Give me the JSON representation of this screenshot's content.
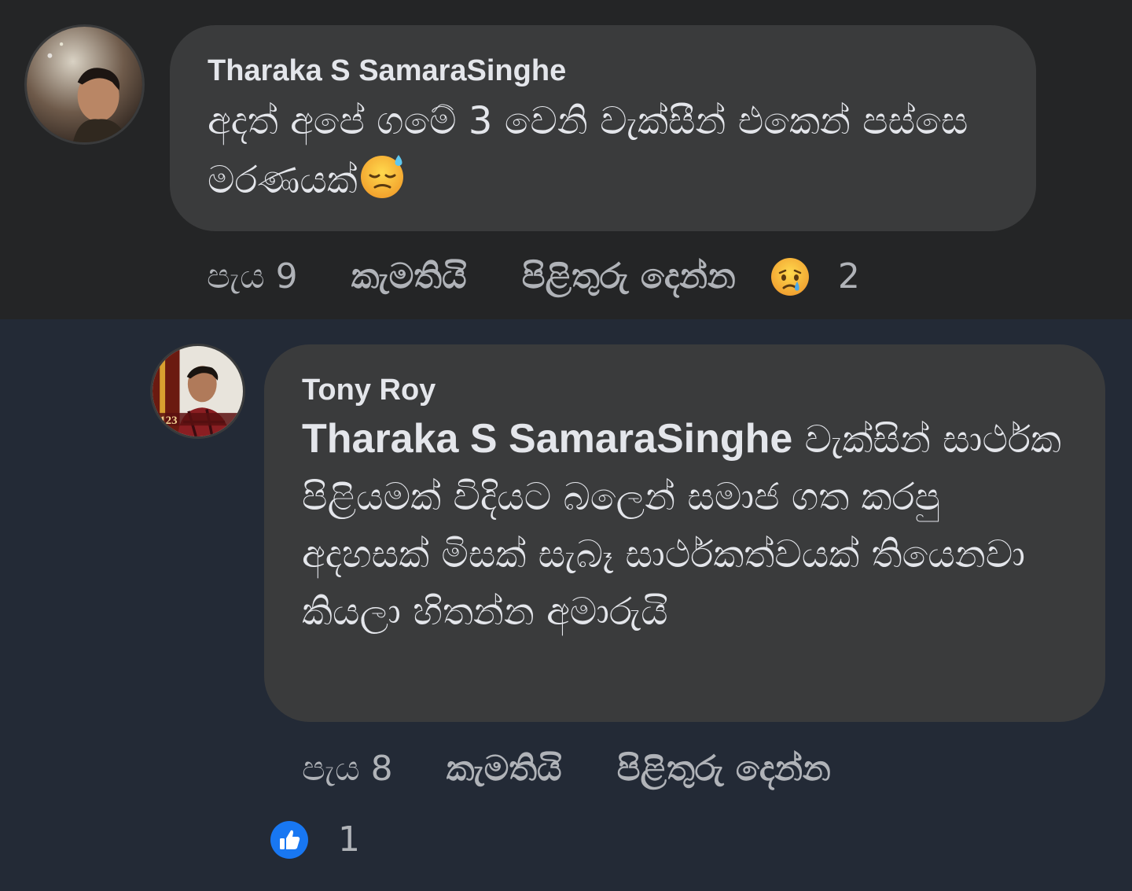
{
  "comments": [
    {
      "author": "Tharaka S SamaraSinghe",
      "text": "අදත් අපේ ගමේ 3 වෙනි වැක්සීන් එකෙන් පස්සෙ මරණයක්",
      "emoji_icon": "downcast-face-with-sweat-emoji",
      "time": "පැය 9",
      "like_label": "කැමතියි",
      "reply_label": "පිළිතුරු දෙන්න",
      "reaction_icon": "crying-face-emoji",
      "reaction_count": "2"
    },
    {
      "author": "Tony Roy",
      "mention": "Tharaka S SamaraSinghe",
      "text": " වැක්සින් සාර්ථක පිළියමක් විදියට බලෙන් සමාජ ගත කරපු අදහසක් මිසක් සැබෑ සාර්ථකත්වයක් තියෙනවා කියලා හිතන්න අමාරුයි",
      "time": "පැය 8",
      "like_label": "කැමතියි",
      "reply_label": "පිළිතුරු දෙන්න",
      "reaction_icon": "thumbs-up-icon",
      "reaction_count": "1"
    }
  ],
  "colors": {
    "background_top": "#242526",
    "background_bottom": "#232a36",
    "bubble": "#3a3b3c",
    "text_primary": "#e4e6eb",
    "text_secondary": "#b0b3b8",
    "like_blue": "#1877f2"
  }
}
